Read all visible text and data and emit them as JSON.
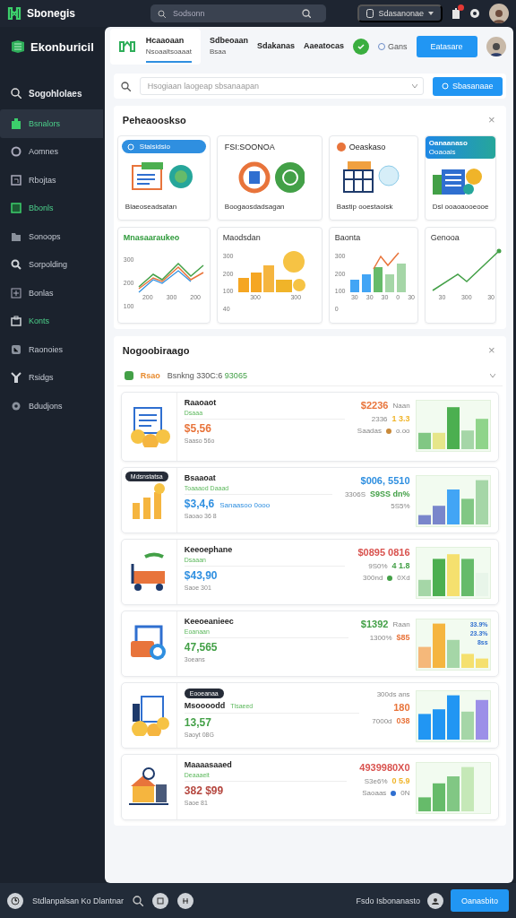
{
  "top_bar": {
    "brand": "Sbonegis",
    "search": {
      "placeholder": "Sodsonn"
    },
    "account": "Sdasanonae",
    "notifications": true
  },
  "sidebar": {
    "title": "Ekonburicil",
    "search_item": "Sogohlolaes",
    "items": [
      {
        "label": "Bsnalors",
        "selected": true,
        "accent": false
      },
      {
        "label": "Aomnes",
        "selected": false,
        "accent": false
      },
      {
        "label": "Rbojtas",
        "selected": false,
        "accent": false
      },
      {
        "label": "Bbonls",
        "selected": false,
        "accent": true
      },
      {
        "label": "Sonoops",
        "selected": false,
        "accent": false
      },
      {
        "label": "Sorpolding",
        "selected": false,
        "accent": false
      },
      {
        "label": "Bonlas",
        "selected": false,
        "accent": false
      },
      {
        "label": "Konts",
        "selected": false,
        "accent": true
      },
      {
        "label": "Raonoies",
        "selected": false,
        "accent": false
      },
      {
        "label": "Rsidgs",
        "selected": false,
        "accent": false
      },
      {
        "label": "Bdudjons",
        "selected": false,
        "accent": false
      }
    ]
  },
  "header": {
    "tabs": [
      {
        "label": "Hcaaoaan",
        "sub": "Nsoaaltsoaaat",
        "selected": true
      },
      {
        "label": "Sdbeoaan",
        "sub": "Bsaa",
        "selected": false
      },
      {
        "label": "Sdakanas",
        "selected": false
      },
      {
        "label": "Aaeatocas",
        "selected": false
      }
    ],
    "option": {
      "label": "Gans",
      "checked": false
    },
    "button": "Eatasare"
  },
  "search": {
    "placeholder": "Hsogiaan laogeap sbsanaapan",
    "button": "Sbasanaae"
  },
  "overview": {
    "title": "Peheaooskso",
    "close": "×",
    "tiles": [
      {
        "pill": "Stalsidsio",
        "caption": "Blaeoseadsatan"
      },
      {
        "title": "FSI:SOONOA",
        "caption": "Boogaosdadsagan"
      },
      {
        "title": "Oeaskaso",
        "caption": "Bastip ooestaoisk"
      },
      {
        "banner": "Oanaanaso",
        "banner_sub": "Ooaoais",
        "caption": "Dsl ooaoaooeooe"
      }
    ],
    "charts": [
      {
        "kind": "lines",
        "title": "Mnasaaraukeo",
        "accent": true,
        "y_ticks": [
          "300",
          "200",
          "100"
        ],
        "x_ticks": [
          "200",
          "300",
          "200"
        ]
      },
      {
        "kind": "coins",
        "title": "Maodsdan",
        "accent": false,
        "y_ticks": [
          "300",
          "200",
          "100",
          "40"
        ],
        "x_ticks": [
          "300",
          "300"
        ]
      },
      {
        "kind": "barline",
        "title": "Baonta",
        "accent": false,
        "y_ticks": [
          "300",
          "200",
          "100",
          "0"
        ],
        "x_ticks": [
          "30",
          "30",
          "30",
          "0",
          "30"
        ]
      },
      {
        "kind": "rise",
        "title": "Genooa",
        "accent": false,
        "x_ticks": [
          "30",
          "300",
          "30"
        ]
      }
    ]
  },
  "records": {
    "title": "Nogoobiraago",
    "close": "×",
    "filter": {
      "tag": "Rsao",
      "text": "Bsnkng 330C:6 ",
      "highlight": "93065"
    },
    "rows": [
      {
        "title": "Raaoaot",
        "sub": "Dsaaa",
        "amount": {
          "text": "$5,56",
          "color": "#e8743b"
        },
        "note": "Saaso 56o",
        "top": {
          "text": "$2236",
          "color": "#e8743b"
        },
        "top_unit": "Naan",
        "mid_label": "2336",
        "mid": {
          "text": "1 3.3",
          "color": "#f0b429"
        },
        "low_label": "Saadas",
        "dot": {
          "color": "#c98a3a"
        },
        "low_value": "o.oo"
      },
      {
        "badge": "Mdsnstatsa",
        "title": "Bsaaoat",
        "sub": "Toaaaod Daaad",
        "amount": {
          "text": "$3,4,6",
          "color": "#2f8fe0"
        },
        "amount_extra": "Sanaasoo 0ooo",
        "note": "Saoao 36 8",
        "top": {
          "text": "$006, 5510",
          "color": "#2f8fe0"
        },
        "mid_label": "3306S",
        "mid": {
          "text": "S9SS dn%",
          "color": "#43a047"
        },
        "low_label": "5S5%"
      },
      {
        "title": "Keeoephane",
        "sub": "Dsaaan",
        "amount": {
          "text": "$43,90",
          "color": "#2f8fe0"
        },
        "note": "Saoe 301",
        "top": {
          "text": "$0895 0816",
          "color": "#d9534f"
        },
        "mid_label": "9S0%",
        "mid": {
          "text": "4 1.8",
          "color": "#43a047"
        },
        "low_label": "300nd",
        "dot": {
          "color": "#43a047"
        },
        "low_value": "0Xd"
      },
      {
        "title": "Keeoeanieec",
        "sub": "Eoanaan",
        "amount": {
          "text": "47,565",
          "color": "#43a047"
        },
        "note": "3oeans",
        "top": {
          "text": "$1392",
          "color": "#43a047"
        },
        "top_unit": "Raan",
        "mid_label": "1300%",
        "mid": {
          "text": "$85",
          "color": "#e8743b"
        },
        "bar_labels": [
          "33.9%",
          "23.3%",
          "8ss"
        ]
      },
      {
        "badge": "Eooeanaa",
        "title": "Msoooodd",
        "title_tag": "Tlsaeed",
        "amount": {
          "text": "13,57",
          "color": "#43a047"
        },
        "note": "Saoyt 08G",
        "top_label": "300ds ans",
        "mid": {
          "text": "180",
          "color": "#e8743b"
        },
        "low_label": "7000d",
        "low": {
          "text": "038",
          "color": "#e8743b"
        }
      },
      {
        "title": "Maaaasaaed",
        "sub": "Deaaaeit",
        "amount": {
          "text": "382 $99",
          "color": "#b5473f"
        },
        "note": "Saoe 81",
        "top": {
          "text": "4939980X0",
          "color": "#d9534f"
        },
        "mid_label": "S3e6%",
        "mid": {
          "text": "0 5.9",
          "color": "#f0b429"
        },
        "low_label": "Saoaas",
        "dot": {
          "color": "#2f6fd0"
        },
        "low_value": "0N"
      }
    ]
  },
  "bottom_bar": {
    "status": "Stdlanpalsan Ko Dlantnar",
    "info": "Fsdo Isbonanasto",
    "button": "Oanasbito"
  }
}
